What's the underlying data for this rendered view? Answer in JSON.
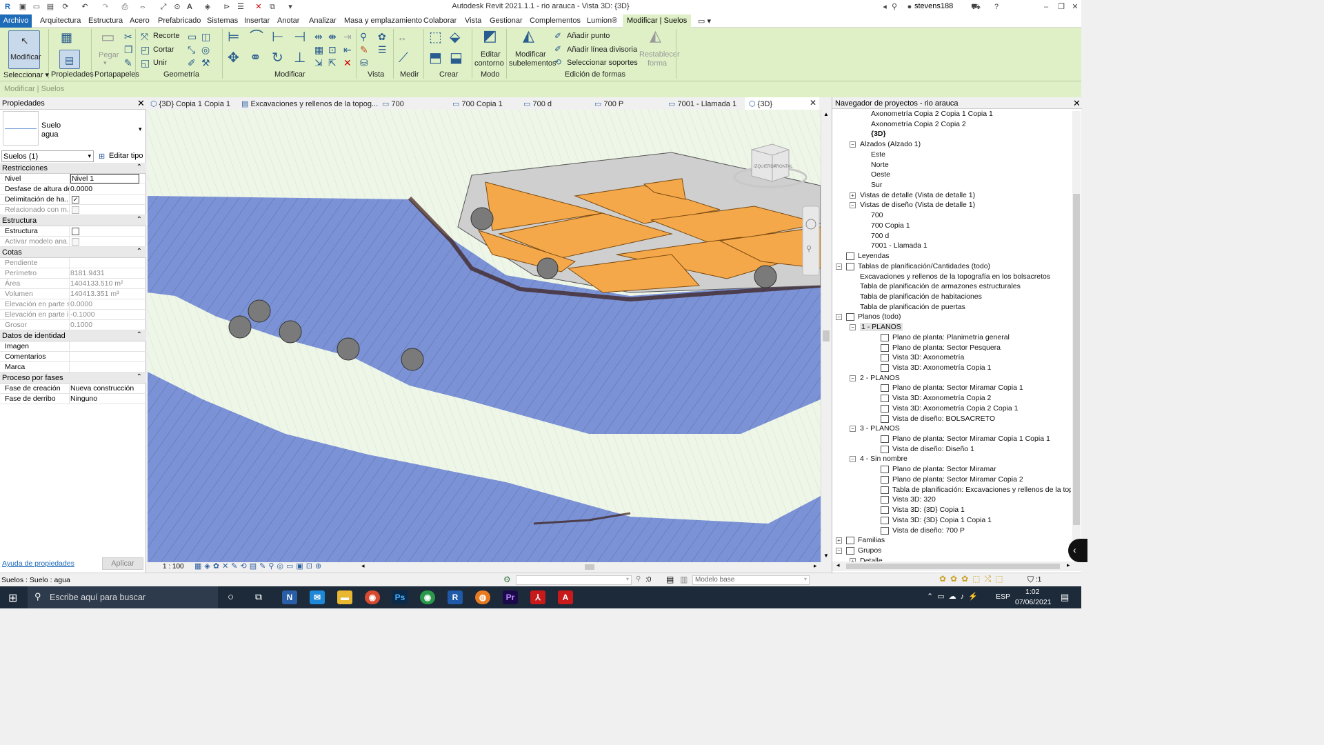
{
  "app": {
    "title": "Autodesk Revit 2021.1.1 - rio arauca - Vista 3D: {3D}",
    "user": "stevens188"
  },
  "menubar": {
    "file": "Archivo",
    "items": [
      "Arquitectura",
      "Estructura",
      "Acero",
      "Prefabricado",
      "Sistemas",
      "Insertar",
      "Anotar",
      "Analizar",
      "Masa y emplazamiento",
      "Colaborar",
      "Vista",
      "Gestionar",
      "Complementos",
      "Lumion®"
    ],
    "active": "Modificar | Suelos"
  },
  "ribbon": {
    "modificar": "Modificar",
    "pegar": "Pegar",
    "recorte": "Recorte",
    "cortar": "Cortar",
    "unir": "Unir",
    "editar_contorno": [
      "Editar",
      "contorno"
    ],
    "modificar_subelementos": [
      "Modificar",
      "subelementos"
    ],
    "anadir_punto": "Añadir punto",
    "anadir_linea": "Añadir línea divisoria",
    "seleccionar_soportes": "Seleccionar soportes",
    "restablecer_forma": [
      "Restablecer",
      "forma"
    ],
    "groups": {
      "seleccionar": "Seleccionar",
      "propiedades": "Propiedades",
      "portapapeles": "Portapapeles",
      "geometria": "Geometría",
      "modificar": "Modificar",
      "vista": "Vista",
      "medir": "Medir",
      "crear": "Crear",
      "modo": "Modo",
      "edicion_formas": "Edición de formas"
    }
  },
  "context_bar": "Modificar | Suelos",
  "properties": {
    "header": "Propiedades",
    "type_name": "Suelo",
    "type_sub": "agua",
    "selector": "Suelos (1)",
    "edit_type": "Editar tipo",
    "sections": {
      "restricciones": "Restricciones",
      "estructura": "Estructura",
      "cotas": "Cotas",
      "identidad": "Datos de identidad",
      "fases": "Proceso por fases"
    },
    "restricciones": [
      {
        "k": "Nivel",
        "v": "Nivel 1"
      },
      {
        "k": "Desfase de altura de...",
        "v": "0.0000"
      },
      {
        "k": "Delimitación de ha...",
        "v": "✓"
      },
      {
        "k": "Relacionado con m...",
        "v": ""
      }
    ],
    "estructura": [
      {
        "k": "Estructura",
        "v": ""
      },
      {
        "k": "Activar modelo ana...",
        "v": ""
      }
    ],
    "cotas": [
      {
        "k": "Pendiente",
        "v": ""
      },
      {
        "k": "Perímetro",
        "v": "8181.9431"
      },
      {
        "k": "Área",
        "v": "1404133.510 m²"
      },
      {
        "k": "Volumen",
        "v": "140413.351 m³"
      },
      {
        "k": "Elevación en parte s...",
        "v": "0.0000"
      },
      {
        "k": "Elevación en parte i...",
        "v": "-0.1000"
      },
      {
        "k": "Grosor",
        "v": "0.1000"
      }
    ],
    "identidad": [
      {
        "k": "Imagen",
        "v": ""
      },
      {
        "k": "Comentarios",
        "v": ""
      },
      {
        "k": "Marca",
        "v": ""
      }
    ],
    "fases": [
      {
        "k": "Fase de creación",
        "v": "Nueva construcción"
      },
      {
        "k": "Fase de derribo",
        "v": "Ninguno"
      }
    ],
    "help_link": "Ayuda de propiedades",
    "apply": "Aplicar"
  },
  "tabs": [
    "{3D} Copia 1 Copia 1",
    "Excavaciones y rellenos de la topog...",
    "700",
    "700 Copia 1",
    "700 d",
    "700 P",
    "7001 - Llamada 1",
    "{3D}"
  ],
  "viewcube": {
    "left": "IZQUIERDA",
    "front": "FRONTAL"
  },
  "viewbar": {
    "scale": "1 : 100"
  },
  "browser": {
    "header": "Navegador de proyectos - rio arauca",
    "items": [
      {
        "t": "Axonometría Copia 2 Copia 1 Copia 1",
        "lvl": 3
      },
      {
        "t": "Axonometría Copia 2 Copia 2",
        "lvl": 3
      },
      {
        "t": "{3D}",
        "lvl": 3,
        "bold": true
      },
      {
        "t": "Alzados (Alzado 1)",
        "lvl": 2,
        "tog": "−"
      },
      {
        "t": "Este",
        "lvl": 3
      },
      {
        "t": "Norte",
        "lvl": 3
      },
      {
        "t": "Oeste",
        "lvl": 3
      },
      {
        "t": "Sur",
        "lvl": 3
      },
      {
        "t": "Vistas de detalle (Vista de detalle 1)",
        "lvl": 2,
        "tog": "+"
      },
      {
        "t": "Vistas de diseño (Vista de detalle 1)",
        "lvl": 2,
        "tog": "−"
      },
      {
        "t": "700",
        "lvl": 3
      },
      {
        "t": "700 Copia 1",
        "lvl": 3
      },
      {
        "t": "700 d",
        "lvl": 3
      },
      {
        "t": "7001 - Llamada 1",
        "lvl": 3
      },
      {
        "t": "Leyendas",
        "lvl": 1,
        "icon": true
      },
      {
        "t": "Tablas de planificación/Cantidades (todo)",
        "lvl": 1,
        "tog": "−",
        "icon": true
      },
      {
        "t": "Excavaciones y rellenos de la topografía en los bolsacretos",
        "lvl": 2
      },
      {
        "t": "Tabla de planificación de armazones estructurales",
        "lvl": 2
      },
      {
        "t": "Tabla de planificación de habitaciones",
        "lvl": 2
      },
      {
        "t": "Tabla de planificación de puertas",
        "lvl": 2
      },
      {
        "t": "Planos (todo)",
        "lvl": 1,
        "tog": "−",
        "icon": true
      },
      {
        "t": "1 - PLANOS",
        "lvl": 2,
        "tog": "−",
        "sel": true
      },
      {
        "t": "Plano de planta: Planimetría general",
        "lvl": 4,
        "icon": true
      },
      {
        "t": "Plano de planta: Sector Pesquera",
        "lvl": 4,
        "icon": true
      },
      {
        "t": "Vista 3D: Axonometría",
        "lvl": 4,
        "icon": true
      },
      {
        "t": "Vista 3D: Axonometría Copia 1",
        "lvl": 4,
        "icon": true
      },
      {
        "t": "2 - PLANOS",
        "lvl": 2,
        "tog": "−"
      },
      {
        "t": "Plano de planta: Sector Miramar Copia 1",
        "lvl": 4,
        "icon": true
      },
      {
        "t": "Vista 3D: Axonometría Copia 2",
        "lvl": 4,
        "icon": true
      },
      {
        "t": "Vista 3D: Axonometría Copia 2 Copia 1",
        "lvl": 4,
        "icon": true
      },
      {
        "t": "Vista de diseño: BOLSACRETO",
        "lvl": 4,
        "icon": true
      },
      {
        "t": "3 - PLANOS",
        "lvl": 2,
        "tog": "−"
      },
      {
        "t": "Plano de planta: Sector Miramar Copia 1 Copia 1",
        "lvl": 4,
        "icon": true
      },
      {
        "t": "Vista de diseño: Diseño 1",
        "lvl": 4,
        "icon": true
      },
      {
        "t": "4 - Sin nombre",
        "lvl": 2,
        "tog": "−"
      },
      {
        "t": "Plano de planta: Sector Miramar",
        "lvl": 4,
        "icon": true
      },
      {
        "t": "Plano de planta: Sector Miramar Copia 2",
        "lvl": 4,
        "icon": true
      },
      {
        "t": "Tabla de planificación: Excavaciones y rellenos de la topografía er",
        "lvl": 4,
        "icon": true
      },
      {
        "t": "Vista 3D: 320",
        "lvl": 4,
        "icon": true
      },
      {
        "t": "Vista 3D: {3D} Copia 1",
        "lvl": 4,
        "icon": true
      },
      {
        "t": "Vista 3D: {3D} Copia 1 Copia 1",
        "lvl": 4,
        "icon": true
      },
      {
        "t": "Vista de diseño: 700 P",
        "lvl": 4,
        "icon": true
      },
      {
        "t": "Familias",
        "lvl": 1,
        "tog": "+",
        "icon": true
      },
      {
        "t": "Grupos",
        "lvl": 1,
        "tog": "−",
        "icon": true
      },
      {
        "t": "Detalle",
        "lvl": 2,
        "tog": "+"
      }
    ]
  },
  "status": {
    "left": "Suelos : Suelo : agua",
    "count": ":0",
    "model": "Modelo base",
    "filter": ":1"
  },
  "taskbar": {
    "search": "Escribe aquí para buscar",
    "lang": "ESP",
    "time": "1:02",
    "date": "07/06/2021"
  },
  "colors": {
    "ribbon_bg": "#dff0c6",
    "accent": "#1e6bb8",
    "water": "#7b93d6",
    "building": "#f5a84a",
    "terrain": "#eef6e8"
  }
}
